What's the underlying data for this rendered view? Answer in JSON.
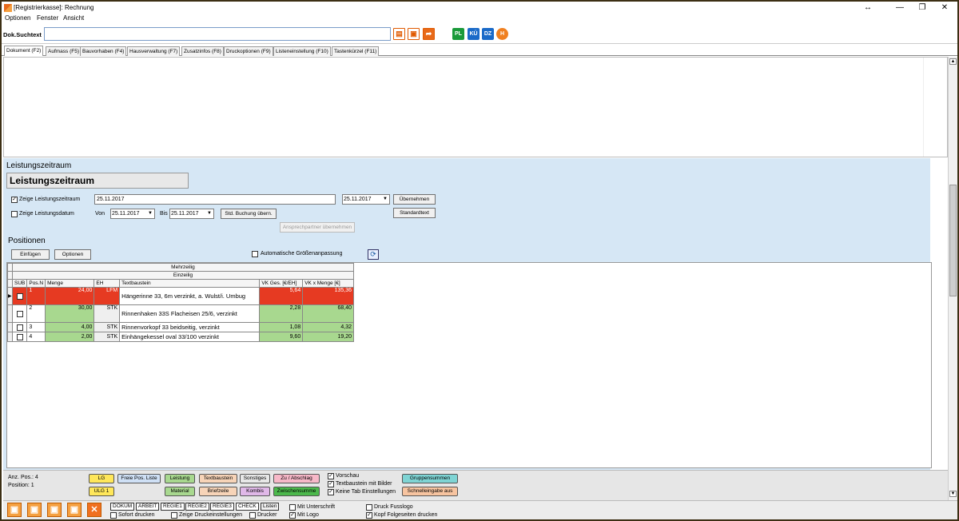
{
  "window": {
    "title": "[Registrierkasse]: Rechnung",
    "controls": [
      "↔",
      "—",
      "❐",
      "✕"
    ]
  },
  "menu": [
    "Optionen",
    "Fenster",
    "Ansicht"
  ],
  "search": {
    "label": "Dok.Suchtext",
    "value": ""
  },
  "toolbar_tags": [
    {
      "label": "PL",
      "color": "#1a9a3a"
    },
    {
      "label": "KÜ",
      "color": "#1a6ac8"
    },
    {
      "label": "DZ",
      "color": "#1a6ac8"
    },
    {
      "label": "H",
      "color": "#f08020"
    }
  ],
  "tabs": [
    "Dokument (F2)",
    "Aufmass (F5)",
    "Bauvorhaben (F4)",
    "Hausverwaltung (F7)",
    "Zusatzinfos (F8)",
    "Druckoptionen (F9)",
    "Listeneinstellung (F10)",
    "Tastenkürzel (F11)"
  ],
  "lz": {
    "section": "Leistungszeitraum",
    "title": "Leistungszeitraum",
    "show_period_label": "Zeige Leistungszeitraum",
    "show_period_checked": true,
    "period_value": "25.11.2017",
    "period_dropdown": "25.11.2017",
    "btn_apply": "Übernehmen",
    "show_date_label": "Zeige Leistungsdatum",
    "show_date_checked": false,
    "von_label": "Von",
    "von_value": "25.11.2017",
    "bis_label": "Bis",
    "bis_value": "25.11.2017",
    "btn_std": "Std. Buchung übern.",
    "btn_standardtext": "Standardtext",
    "btn_contact": "Ansprechpartner übernehmen"
  },
  "positions": {
    "section": "Positionen",
    "btn_insert": "Einfügen",
    "btn_options": "Optionen",
    "auto_size_label": "Automatische Größenanpassung",
    "group1": "Mehrzeilig",
    "group2": "Einzeilig",
    "columns": [
      "SUB",
      "Pos.N",
      "Menge",
      "EH",
      "Textbaustein",
      "VK Ges. [€/EH]",
      "VK x Menge [€]"
    ],
    "rows": [
      {
        "pos": "1",
        "menge": "24,00",
        "eh": "LFM",
        "text": "Hängerinne 33, 6m verzinkt, a. Wulst/i. Umbug",
        "vk": "5,64",
        "sum": "135,36"
      },
      {
        "pos": "2",
        "menge": "30,00",
        "eh": "STK",
        "text": "Rinnenhaken 33S Flacheisen 25/6, verzinkt",
        "vk": "2,28",
        "sum": "68,40"
      },
      {
        "pos": "3",
        "menge": "4,00",
        "eh": "STK",
        "text": "Rinnenvorkopf 33 beidseitig, verzinkt",
        "vk": "1,08",
        "sum": "4,32"
      },
      {
        "pos": "4",
        "menge": "2,00",
        "eh": "STK",
        "text": "Einhängekessel oval 33/100 verzinkt",
        "vk": "9,60",
        "sum": "19,20"
      }
    ]
  },
  "footer": {
    "anz_pos": "Anz. Pos.: 4",
    "position": "Position: 1",
    "buttons_row1": [
      {
        "label": "LG",
        "color": "#ffe75a"
      },
      {
        "label": "Freie Pos. Liste",
        "color": "#cfe0f5"
      },
      {
        "label": "Leistung",
        "color": "#a8d88f"
      },
      {
        "label": "Textbaustein",
        "color": "#f7d4b8"
      },
      {
        "label": "Sonstiges",
        "color": "#e8e8e8"
      },
      {
        "label": "Zu / Abschlag",
        "color": "#f7b8c8"
      }
    ],
    "buttons_row2": [
      {
        "label": "ULG 1",
        "color": "#ffe75a"
      },
      {
        "label": "Material",
        "color": "#a8d88f"
      },
      {
        "label": "Briefzeile",
        "color": "#f7d4b8"
      },
      {
        "label": "Kombis",
        "color": "#e0b8e8"
      },
      {
        "label": "Zwischensumme",
        "color": "#4cb84c"
      }
    ],
    "checks": [
      {
        "label": "Vorschau",
        "checked": true
      },
      {
        "label": "Textbaustein mit Bilder",
        "checked": true
      },
      {
        "label": "Keine Tab Einstellungen",
        "checked": true
      }
    ],
    "btn_groups": "Gruppensummen",
    "btn_quick": "Schnelleingabe aus"
  },
  "bottom": {
    "sections": [
      "DOKUM",
      "ARBEIT",
      "REGIE1",
      "REGIE2",
      "REGIE3",
      "CHECK"
    ],
    "btn_lists": "Listen",
    "checks": [
      {
        "label": "Sofort drucken",
        "checked": false
      },
      {
        "label": "Zeige Druckeinstellungen",
        "checked": false
      },
      {
        "label": "Drucker",
        "checked": false
      },
      {
        "label": "Mit Unterschrift",
        "checked": false
      },
      {
        "label": "Mit Logo",
        "checked": true
      },
      {
        "label": "Druck Fusslogo",
        "checked": false
      },
      {
        "label": "Kopf Folgeseiten drucken",
        "checked": true
      }
    ]
  }
}
